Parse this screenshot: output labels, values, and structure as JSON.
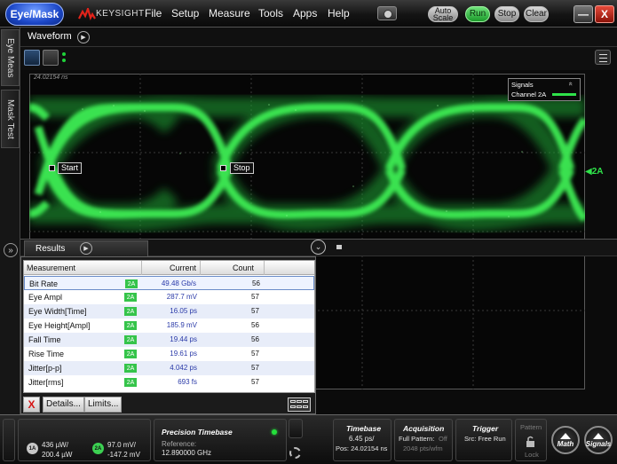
{
  "menubar": {
    "eye_mask_label": "Eye/Mask",
    "brand": "KEYSIGHT",
    "menus": [
      "File",
      "Setup",
      "Measure",
      "Tools",
      "Apps",
      "Help"
    ],
    "auto_scale": [
      "Auto",
      "Scale"
    ],
    "run": "Run",
    "stop": "Stop",
    "clear": "Clear",
    "minimize": "—",
    "close": "X"
  },
  "left_tabs": {
    "eye_meas": "Eye Meas",
    "mask_test": "Mask Test",
    "expand": "»"
  },
  "waveform": {
    "title": "Waveform",
    "timestamp": "24.02154 ns",
    "start_label": "Start",
    "stop_label": "Stop",
    "channel_marker": "2A",
    "signals": {
      "title": "Signals",
      "channel": "Channel 2A",
      "chevron": "«"
    }
  },
  "results": {
    "tab_title": "Results",
    "columns": {
      "measurement": "Measurement",
      "current": "Current",
      "count": "Count"
    },
    "rows": [
      {
        "name": "Bit Rate",
        "source": "2A",
        "current": "49.48 Gb/s",
        "count": "56"
      },
      {
        "name": "Eye Ampl",
        "source": "2A",
        "current": "287.7 mV",
        "count": "57"
      },
      {
        "name": "Eye Width[Time]",
        "source": "2A",
        "current": "16.05 ps",
        "count": "57"
      },
      {
        "name": "Eye Height[Ampl]",
        "source": "2A",
        "current": "185.9 mV",
        "count": "56"
      },
      {
        "name": "Fall Time",
        "source": "2A",
        "current": "19.44 ps",
        "count": "56"
      },
      {
        "name": "Rise Time",
        "source": "2A",
        "current": "19.61 ps",
        "count": "57"
      },
      {
        "name": "Jitter[p-p]",
        "source": "2A",
        "current": "4.042 ps",
        "count": "57"
      },
      {
        "name": "Jitter[rms]",
        "source": "2A",
        "current": "693 fs",
        "count": "57"
      }
    ],
    "details_button": "Details...",
    "limits_button": "Limits...",
    "delete_button": "X"
  },
  "statusbar": {
    "ch1": {
      "label": "1A",
      "line1": "436 µW/",
      "line2": "200.4 µW"
    },
    "ch2": {
      "label": "2A",
      "line1": "97.0 mV/",
      "line2": "-147.2 mV"
    },
    "precision_timebase": {
      "title": "Precision Timebase",
      "reference_label": "Reference:",
      "reference_value": "12.890000 GHz"
    },
    "timebase": {
      "title": "Timebase",
      "scale": "6.45 ps/",
      "position": "Pos: 24.02154 ns"
    },
    "acquisition": {
      "title": "Acquisition",
      "pattern": "Full Pattern:",
      "pattern_state": "Off",
      "pts": "2048 pts/wfm"
    },
    "trigger": {
      "title": "Trigger",
      "source": "Src: Free Run"
    },
    "pattern_lock": {
      "pattern": "Pattern",
      "lock": "Lock"
    },
    "math": "Math",
    "signals": "Signals"
  },
  "colors": {
    "trace": "#2fe24a",
    "accent_blue": "#1c47c8",
    "run_green": "#1b9a2b"
  }
}
